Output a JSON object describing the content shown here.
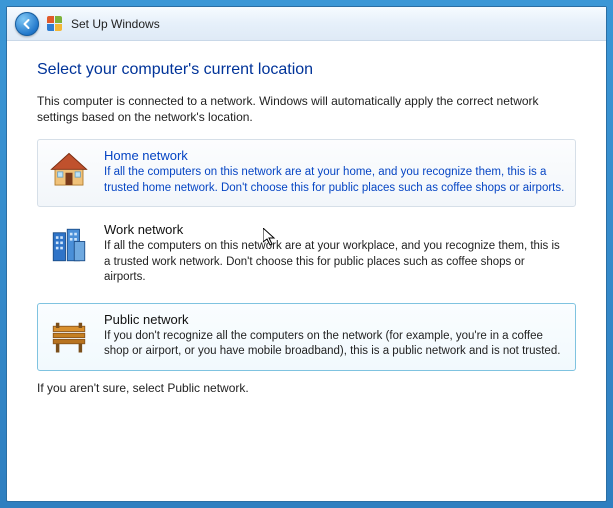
{
  "titlebar": {
    "title": "Set Up Windows"
  },
  "heading": "Select your computer's current location",
  "intro": "This computer is connected to a network. Windows will automatically apply the correct network settings based on the network's location.",
  "options": {
    "home": {
      "title": "Home network",
      "desc": "If all the computers on this network are at your home, and you recognize them, this is a trusted home network.  Don't choose this for public places such as coffee shops or airports."
    },
    "work": {
      "title": "Work network",
      "desc": "If all the computers on this network are at your workplace, and you recognize them, this is a trusted work network.  Don't choose this for public places such as coffee shops or airports."
    },
    "public": {
      "title": "Public network",
      "desc": "If you don't recognize all the computers on the network (for example, you're in a coffee shop or airport, or you have mobile broadband), this is a public network and is not trusted."
    }
  },
  "footnote": "If you aren't sure, select Public network."
}
